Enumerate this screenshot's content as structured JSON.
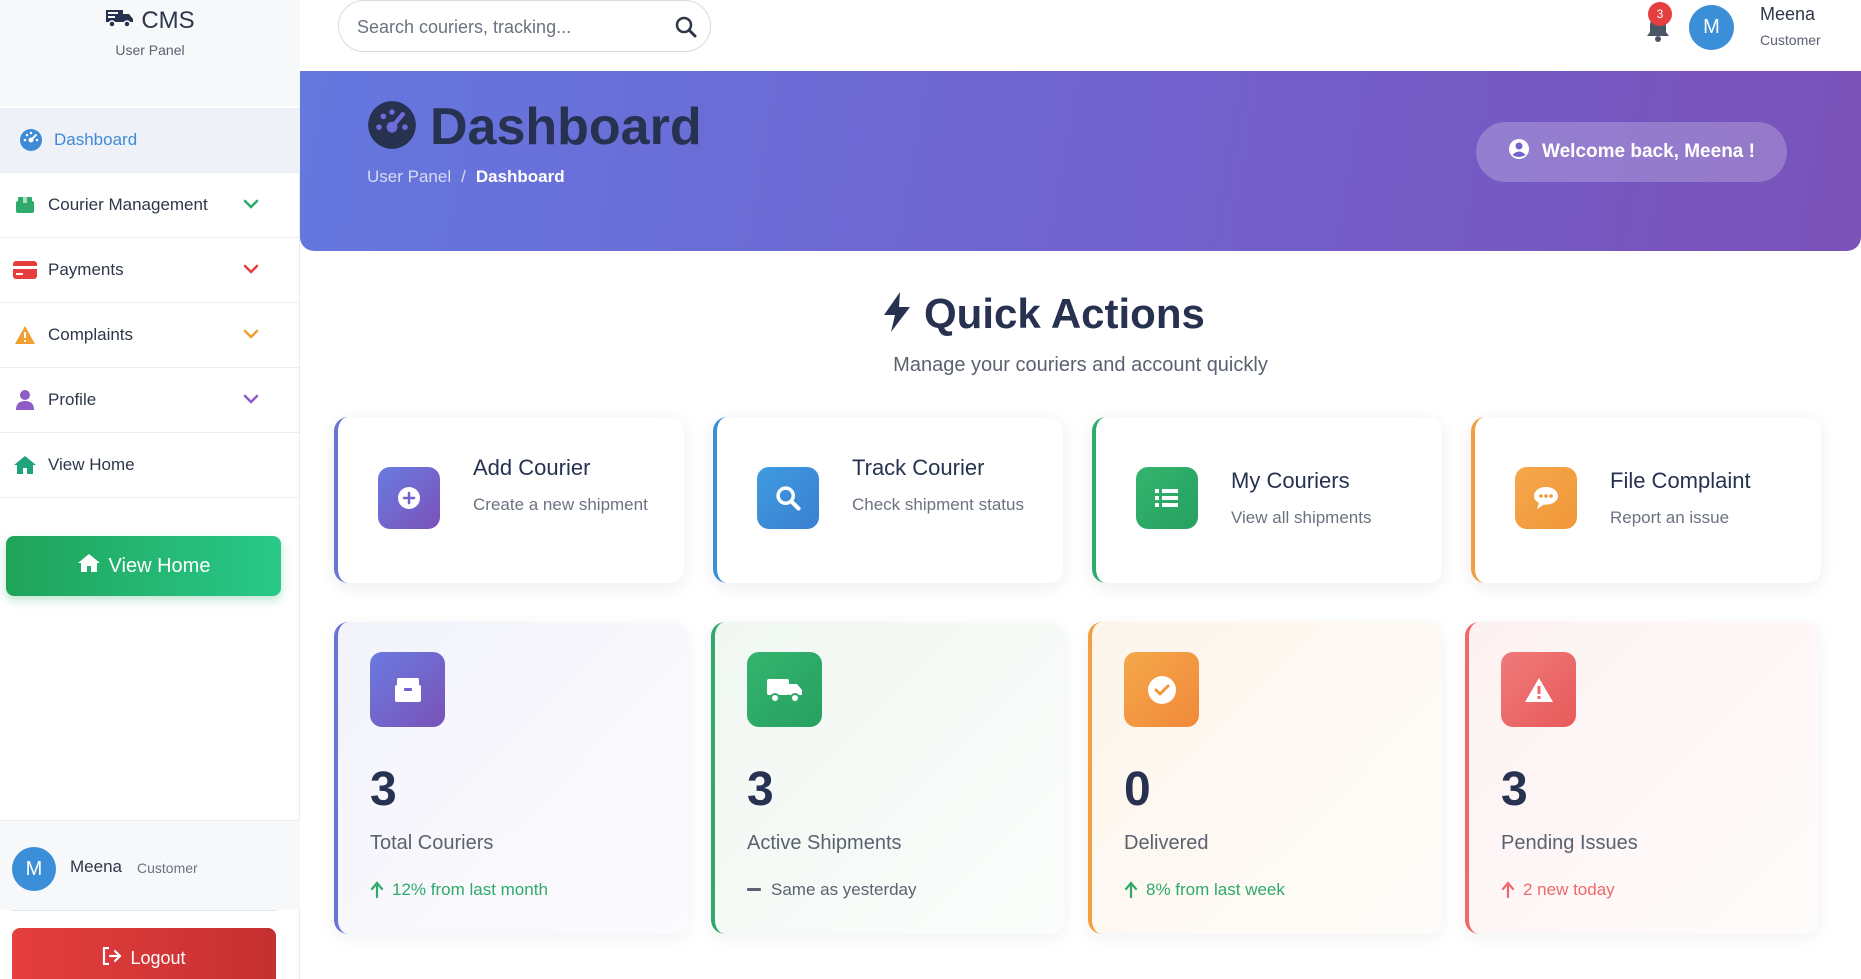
{
  "brand": {
    "name": "CMS",
    "subtitle": "User Panel"
  },
  "sidebar": {
    "items": [
      {
        "label": "Dashboard",
        "icon": "gauge-icon",
        "active": true
      },
      {
        "label": "Courier Management",
        "icon": "box-icon"
      },
      {
        "label": "Payments",
        "icon": "credit-card-icon"
      },
      {
        "label": "Complaints",
        "icon": "warning-icon"
      },
      {
        "label": "Profile",
        "icon": "user-icon"
      },
      {
        "label": "View Home",
        "icon": "home-icon"
      }
    ],
    "home_button": "View Home",
    "user": {
      "initial": "M",
      "name": "Meena",
      "role": "Customer"
    },
    "logout": "Logout"
  },
  "topbar": {
    "search_placeholder": "Search couriers, tracking...",
    "notification_count": "3",
    "user": {
      "initial": "M",
      "name": "Meena",
      "role": "Customer"
    }
  },
  "hero": {
    "title": "Dashboard",
    "breadcrumb": [
      "User Panel",
      "/",
      "Dashboard"
    ],
    "welcome": "Welcome back, Meena !"
  },
  "quick_actions": {
    "title": "Quick Actions",
    "subtitle": "Manage your couriers and account quickly",
    "cards": [
      {
        "title": "Add Courier",
        "desc": "Create a new shipment",
        "icon": "plus-circle-icon",
        "color": "#6b5fc7"
      },
      {
        "title": "Track Courier",
        "desc": "Check shipment status",
        "icon": "search-icon",
        "color": "#3a8fd8"
      },
      {
        "title": "My Couriers",
        "desc": "View all shipments",
        "icon": "list-icon",
        "color": "#2eaa6a"
      },
      {
        "title": "File Complaint",
        "desc": "Report an issue",
        "icon": "comment-icon",
        "color": "#f0a040"
      }
    ]
  },
  "stats": [
    {
      "value": "3",
      "label": "Total Couriers",
      "trend": "12% from last month",
      "trend_type": "up",
      "color": "#6b5fc7",
      "icon": "box-icon"
    },
    {
      "value": "3",
      "label": "Active Shipments",
      "trend": "Same as yesterday",
      "trend_type": "flat",
      "color": "#2eaa6a",
      "icon": "truck-icon"
    },
    {
      "value": "0",
      "label": "Delivered",
      "trend": "8% from last week",
      "trend_type": "up",
      "color": "#f0963a",
      "icon": "check-circle-icon"
    },
    {
      "value": "3",
      "label": "Pending Issues",
      "trend": "2 new today",
      "trend_type": "up-warn",
      "color": "#ee6a6a",
      "icon": "warning-icon"
    }
  ]
}
